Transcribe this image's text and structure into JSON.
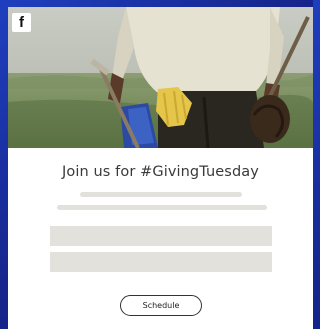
{
  "header": {
    "icon": "facebook-icon",
    "icon_glyph": "f"
  },
  "hero": {
    "alt": "Person carrying gardening tools in a field"
  },
  "content": {
    "title": "Join us for #GivingTuesday"
  },
  "actions": {
    "schedule_label": "Schedule"
  },
  "colors": {
    "background": "#1a2a9e",
    "card": "#ffffff",
    "placeholder": "#e2e1dc",
    "title_text": "#3a3a3a",
    "button_border": "#333333"
  }
}
